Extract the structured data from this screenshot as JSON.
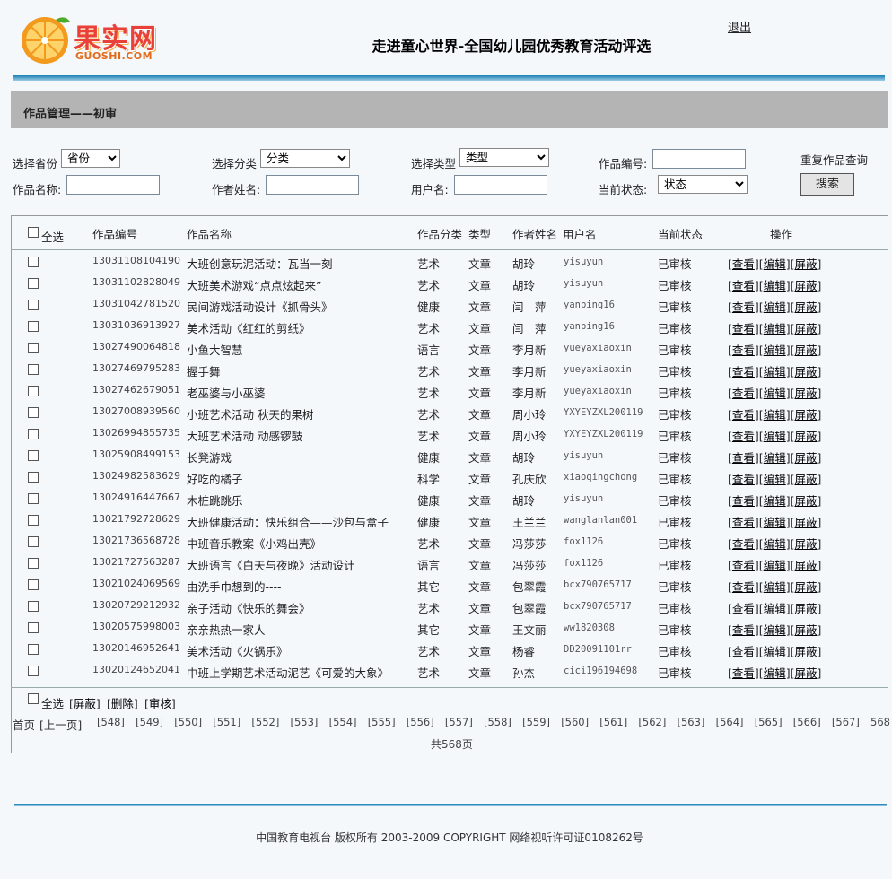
{
  "header": {
    "logo_text": "果实网",
    "logo_sub": "GUOSHI.COM",
    "title": "走进童心世界-全国幼儿园优秀教育活动评选",
    "logout": "退出"
  },
  "section_title": "作品管理——初审",
  "search": {
    "province_label": "选择省份",
    "province_value": "省份",
    "category_label": "选择分类",
    "category_value": "分类",
    "type_label": "选择类型",
    "type_value": "类型",
    "work_no_label": "作品编号:",
    "work_no_value": "",
    "reset_label": "重复作品查询",
    "work_name_label": "作品名称:",
    "work_name_value": "",
    "author_label": "作者姓名:",
    "author_value": "",
    "username_label": "用户名:",
    "username_value": "",
    "status_label": "当前状态:",
    "status_value": "状态",
    "search_button": "搜索"
  },
  "table": {
    "headers": {
      "select_all": "全选",
      "work_no": "作品编号",
      "work_name": "作品名称",
      "category": "作品分类",
      "type": "类型",
      "author": "作者姓名",
      "username": "用户名",
      "status": "当前状态",
      "actions": "操作"
    },
    "action_labels": [
      "查看",
      "编辑",
      "屏蔽"
    ],
    "rows": [
      {
        "no": "13031108104190",
        "name": "大班创意玩泥活动：瓦当一刻",
        "category": "艺术",
        "type": "文章",
        "author": "胡玲",
        "user": "yisuyun",
        "status": "已审核"
      },
      {
        "no": "13031102828049",
        "name": "大班美术游戏“点点炫起来”",
        "category": "艺术",
        "type": "文章",
        "author": "胡玲",
        "user": "yisuyun",
        "status": "已审核"
      },
      {
        "no": "13031042781520",
        "name": "民间游戏活动设计《抓骨头》",
        "category": "健康",
        "type": "文章",
        "author": "闫　萍",
        "user": "yanping16",
        "status": "已审核"
      },
      {
        "no": "13031036913927",
        "name": "美术活动《红红的剪纸》",
        "category": "艺术",
        "type": "文章",
        "author": "闫　萍",
        "user": "yanping16",
        "status": "已审核"
      },
      {
        "no": "13027490064818",
        "name": "小鱼大智慧",
        "category": "语言",
        "type": "文章",
        "author": "李月新",
        "user": "yueyaxiaoxin",
        "status": "已审核"
      },
      {
        "no": "13027469795283",
        "name": "握手舞",
        "category": "艺术",
        "type": "文章",
        "author": "李月新",
        "user": "yueyaxiaoxin",
        "status": "已审核"
      },
      {
        "no": "13027462679051",
        "name": "老巫婆与小巫婆",
        "category": "艺术",
        "type": "文章",
        "author": "李月新",
        "user": "yueyaxiaoxin",
        "status": "已审核"
      },
      {
        "no": "13027008939560",
        "name": "小班艺术活动 秋天的果树",
        "category": "艺术",
        "type": "文章",
        "author": "周小玲",
        "user": "YXYEYZXL200119",
        "status": "已审核"
      },
      {
        "no": "13026994855735",
        "name": "大班艺术活动 动感锣鼓",
        "category": "艺术",
        "type": "文章",
        "author": "周小玲",
        "user": "YXYEYZXL200119",
        "status": "已审核"
      },
      {
        "no": "13025908499153",
        "name": "长凳游戏",
        "category": "健康",
        "type": "文章",
        "author": "胡玲",
        "user": "yisuyun",
        "status": "已审核"
      },
      {
        "no": "13024982583629",
        "name": "好吃的橘子",
        "category": "科学",
        "type": "文章",
        "author": "孔庆欣",
        "user": "xiaoqingchong",
        "status": "已审核"
      },
      {
        "no": "13024916447667",
        "name": "木桩跳跳乐",
        "category": "健康",
        "type": "文章",
        "author": "胡玲",
        "user": "yisuyun",
        "status": "已审核"
      },
      {
        "no": "13021792728629",
        "name": "大班健康活动：快乐组合——沙包与盒子",
        "category": "健康",
        "type": "文章",
        "author": "王兰兰",
        "user": "wanglanlan001",
        "status": "已审核"
      },
      {
        "no": "13021736568728",
        "name": "中班音乐教案《小鸡出壳》",
        "category": "艺术",
        "type": "文章",
        "author": "冯莎莎",
        "user": "fox1126",
        "status": "已审核"
      },
      {
        "no": "13021727563287",
        "name": "大班语言《白天与夜晚》活动设计",
        "category": "语言",
        "type": "文章",
        "author": "冯莎莎",
        "user": "fox1126",
        "status": "已审核"
      },
      {
        "no": "13021024069569",
        "name": "由洗手巾想到的----",
        "category": "其它",
        "type": "文章",
        "author": "包翠霞",
        "user": "bcx790765717",
        "status": "已审核"
      },
      {
        "no": "13020729212932",
        "name": "亲子活动《快乐的舞会》",
        "category": "艺术",
        "type": "文章",
        "author": "包翠霞",
        "user": "bcx790765717",
        "status": "已审核"
      },
      {
        "no": "13020575998003",
        "name": "亲亲热热一家人",
        "category": "其它",
        "type": "文章",
        "author": "王文丽",
        "user": "ww1820308",
        "status": "已审核"
      },
      {
        "no": "13020146952641",
        "name": "美术活动《火锅乐》",
        "category": "艺术",
        "type": "文章",
        "author": "杨睿",
        "user": "DD20091101rr",
        "status": "已审核"
      },
      {
        "no": "13020124652041",
        "name": "中班上学期艺术活动泥艺《可爱的大象》",
        "category": "艺术",
        "type": "文章",
        "author": "孙杰",
        "user": "cici196194698",
        "status": "已审核"
      }
    ],
    "footer_select_all": "全选",
    "bulk_actions": [
      "屏蔽",
      "删除",
      "审核"
    ]
  },
  "pager": {
    "first": "首页",
    "prev": "[上一页]",
    "pages": [
      "[548]",
      "[549]",
      "[550]",
      "[551]",
      "[552]",
      "[553]",
      "[554]",
      "[555]",
      "[556]",
      "[557]",
      "[558]",
      "[559]",
      "[560]",
      "[561]",
      "[562]",
      "[563]",
      "[564]",
      "[565]",
      "[566]",
      "[567]",
      "568"
    ],
    "total": "共568页"
  },
  "footer": {
    "text": "中国教育电视台 版权所有 2003-2009 COPYRIGHT 网络视听许可证0108262号"
  }
}
